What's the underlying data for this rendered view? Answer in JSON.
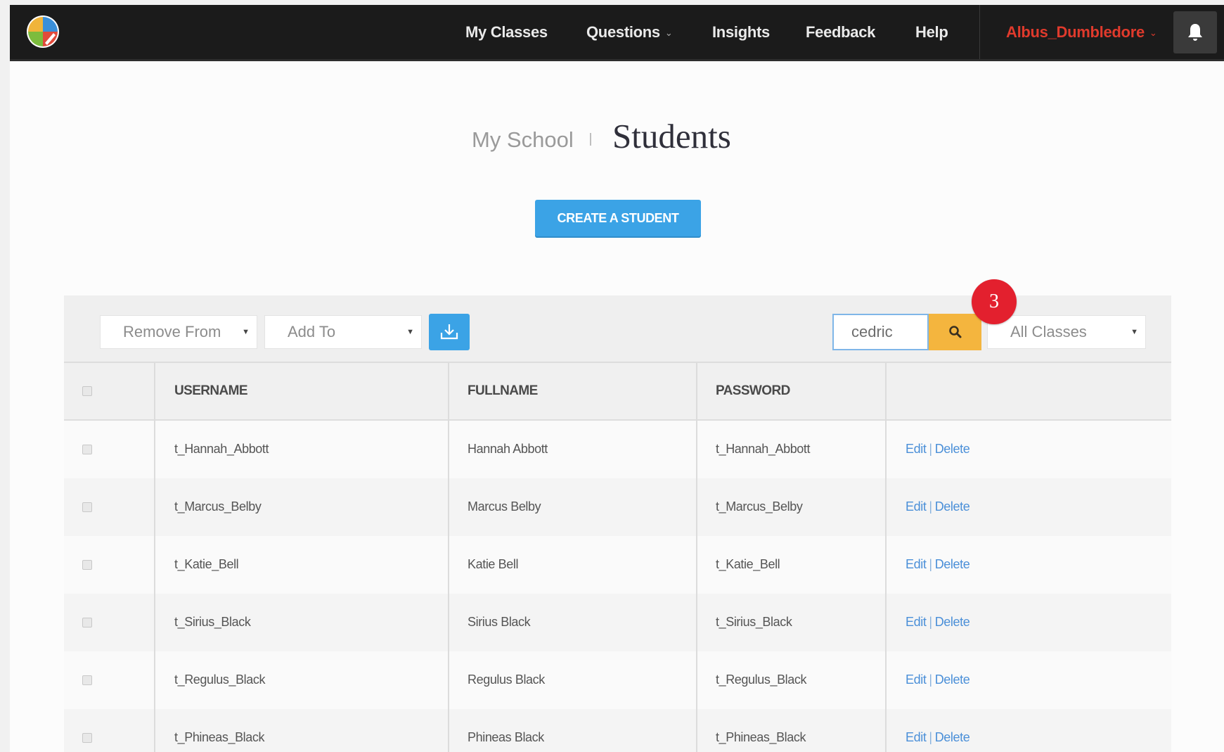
{
  "nav": {
    "items": [
      {
        "label": "My Classes"
      },
      {
        "label": "Questions"
      },
      {
        "label": "Insights"
      },
      {
        "label": "Feedback"
      },
      {
        "label": "Help"
      }
    ],
    "user": "Albus_Dumbledore",
    "icons": {
      "logo": "pie-logo-icon",
      "bell": "bell-icon"
    }
  },
  "header": {
    "breadcrumb": "My School",
    "title": "Students",
    "create_button": "CREATE A STUDENT"
  },
  "toolbar": {
    "remove_from": "Remove From",
    "add_to": "Add To",
    "search_value": "cedric",
    "class_filter": "All Classes",
    "step_number": "3"
  },
  "table": {
    "headers": [
      "USERNAME",
      "FULLNAME",
      "PASSWORD"
    ],
    "edit_label": "Edit",
    "delete_label": "Delete",
    "rows": [
      {
        "username": "t_Hannah_Abbott",
        "fullname": "Hannah Abbott",
        "password": "t_Hannah_Abbott"
      },
      {
        "username": "t_Marcus_Belby",
        "fullname": "Marcus Belby",
        "password": "t_Marcus_Belby"
      },
      {
        "username": "t_Katie_Bell",
        "fullname": "Katie Bell",
        "password": "t_Katie_Bell"
      },
      {
        "username": "t_Sirius_Black",
        "fullname": "Sirius Black",
        "password": "t_Sirius_Black"
      },
      {
        "username": "t_Regulus_Black",
        "fullname": "Regulus Black",
        "password": "t_Regulus_Black"
      },
      {
        "username": "t_Phineas_Black",
        "fullname": "Phineas Black",
        "password": "t_Phineas_Black"
      }
    ]
  },
  "colors": {
    "nav_bg": "#1b1b1b",
    "user_red": "#e03a2c",
    "primary_blue": "#3ba3e6",
    "search_orange": "#f4b53e",
    "badge_red": "#e3202e",
    "link_blue": "#4a8fd8"
  }
}
